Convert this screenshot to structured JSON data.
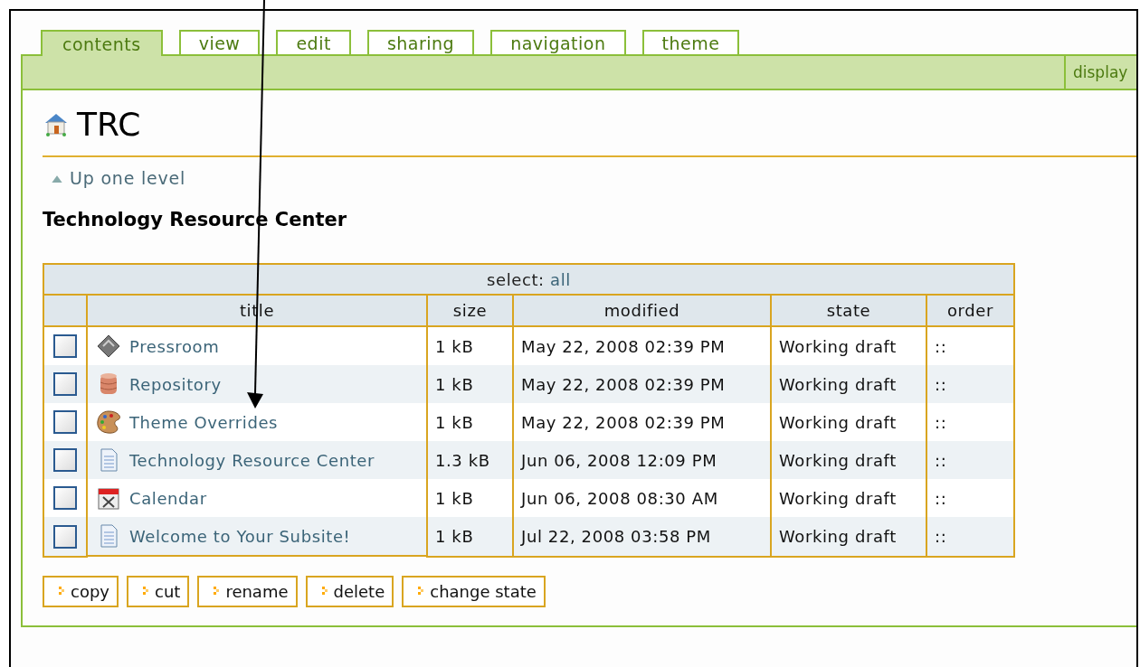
{
  "tabs": [
    {
      "label": "contents",
      "selected": true
    },
    {
      "label": "view",
      "selected": false
    },
    {
      "label": "edit",
      "selected": false
    },
    {
      "label": "sharing",
      "selected": false
    },
    {
      "label": "navigation",
      "selected": false
    },
    {
      "label": "theme",
      "selected": false
    }
  ],
  "toolbar": {
    "menu": "display"
  },
  "folder": {
    "title": "TRC",
    "up_link": "Up one level",
    "description": "Technology Resource Center"
  },
  "table": {
    "select_label": "select:",
    "select_all": "all",
    "columns": [
      "title",
      "size",
      "modified",
      "state",
      "order"
    ],
    "rows": [
      {
        "checked": false,
        "kind": "news",
        "title": "Pressroom",
        "size": "1 kB",
        "modified": "May 22, 2008 02:39 PM",
        "state": "Working draft",
        "order": "::"
      },
      {
        "checked": false,
        "kind": "database",
        "title": "Repository",
        "size": "1 kB",
        "modified": "May 22, 2008 02:39 PM",
        "state": "Working draft",
        "order": "::"
      },
      {
        "checked": false,
        "kind": "palette",
        "title": "Theme Overrides",
        "size": "1 kB",
        "modified": "May 22, 2008 02:39 PM",
        "state": "Working draft",
        "order": "::"
      },
      {
        "checked": false,
        "kind": "document",
        "title": "Technology Resource Center",
        "size": "1.3 kB",
        "modified": "Jun 06, 2008 12:09 PM",
        "state": "Working draft",
        "order": "::"
      },
      {
        "checked": false,
        "kind": "calendar",
        "title": "Calendar",
        "size": "1 kB",
        "modified": "Jun 06, 2008 08:30 AM",
        "state": "Working draft",
        "order": "::"
      },
      {
        "checked": false,
        "kind": "document",
        "title": "Welcome to Your Subsite!",
        "size": "1 kB",
        "modified": "Jul 22, 2008 03:58 PM",
        "state": "Working draft",
        "order": "::"
      }
    ]
  },
  "buttons": [
    "copy",
    "cut",
    "rename",
    "delete",
    "change state"
  ]
}
